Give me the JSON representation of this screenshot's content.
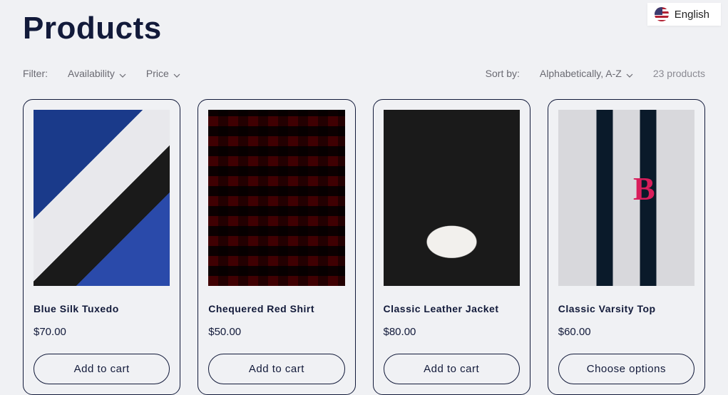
{
  "page": {
    "title": "Products"
  },
  "language": {
    "label": "English"
  },
  "filters": {
    "label": "Filter:",
    "availability": "Availability",
    "price": "Price"
  },
  "sort": {
    "label": "Sort by:",
    "selected": "Alphabetically, A-Z"
  },
  "count_label": "23 products",
  "products": [
    {
      "name": "Blue Silk Tuxedo",
      "price": "$70.00",
      "button": "Add to cart"
    },
    {
      "name": "Chequered Red Shirt",
      "price": "$50.00",
      "button": "Add to cart"
    },
    {
      "name": "Classic Leather Jacket",
      "price": "$80.00",
      "button": "Add to cart"
    },
    {
      "name": "Classic Varsity Top",
      "price": "$60.00",
      "button": "Choose options"
    }
  ]
}
